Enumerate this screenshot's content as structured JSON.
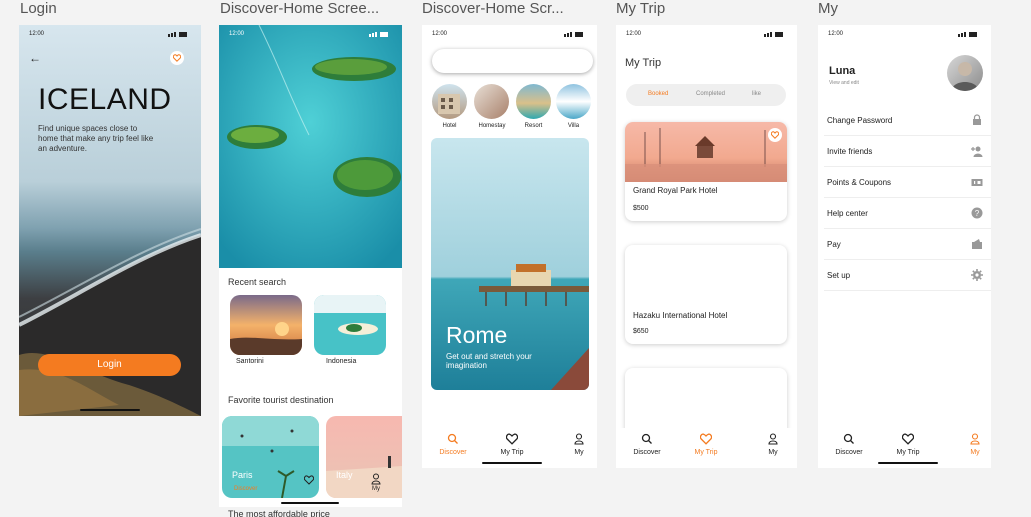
{
  "frames": {
    "login": "Login",
    "discover1": "Discover-Home Scree...",
    "discover2": "Discover-Home Scr...",
    "mytrip": "My Trip",
    "my": "My"
  },
  "status_time": "12:00",
  "login": {
    "title": "ICELAND",
    "description": "Find unique spaces close to home that make any trip feel like an adventure.",
    "button": "Login"
  },
  "discover1": {
    "recent_search_title": "Recent search",
    "recent": [
      {
        "name": "Santorini"
      },
      {
        "name": "Indonesia"
      }
    ],
    "favorite_title": "Favorite tourist destination",
    "favorites": [
      {
        "name": "Paris"
      },
      {
        "name": "Italy"
      }
    ],
    "overlay_discover": "Discover",
    "overlay_my": "My",
    "footer_text": "The most affordable price"
  },
  "discover2": {
    "search_placeholder": "",
    "categories": [
      {
        "label": "Hotel"
      },
      {
        "label": "Homestay"
      },
      {
        "label": "Resort"
      },
      {
        "label": "Villa"
      }
    ],
    "hero_title": "Rome",
    "hero_subtitle": "Get out and stretch your imagination"
  },
  "mytrip": {
    "title": "My Trip",
    "tabs": [
      "Booked",
      "Completed",
      "like"
    ],
    "cards": [
      {
        "name": "Grand Royal Park Hotel",
        "price": "$500"
      },
      {
        "name": "Hazaku International Hotel",
        "price": "$650"
      }
    ]
  },
  "my": {
    "name": "Luna",
    "subtitle": "View and edit",
    "menu": [
      {
        "label": "Change Password",
        "icon": "lock-icon"
      },
      {
        "label": "Invite friends",
        "icon": "add-user-icon"
      },
      {
        "label": "Points & Coupons",
        "icon": "coupon-icon"
      },
      {
        "label": "Help center",
        "icon": "help-icon"
      },
      {
        "label": "Pay",
        "icon": "wallet-icon"
      },
      {
        "label": "Set up",
        "icon": "gear-icon"
      }
    ]
  },
  "nav": {
    "discover": "Discover",
    "mytrip": "My Trip",
    "my": "My"
  },
  "colors": {
    "accent": "#f47b20",
    "ocean": "#2aa5b8",
    "sand_pink": "#f4a9a0"
  }
}
